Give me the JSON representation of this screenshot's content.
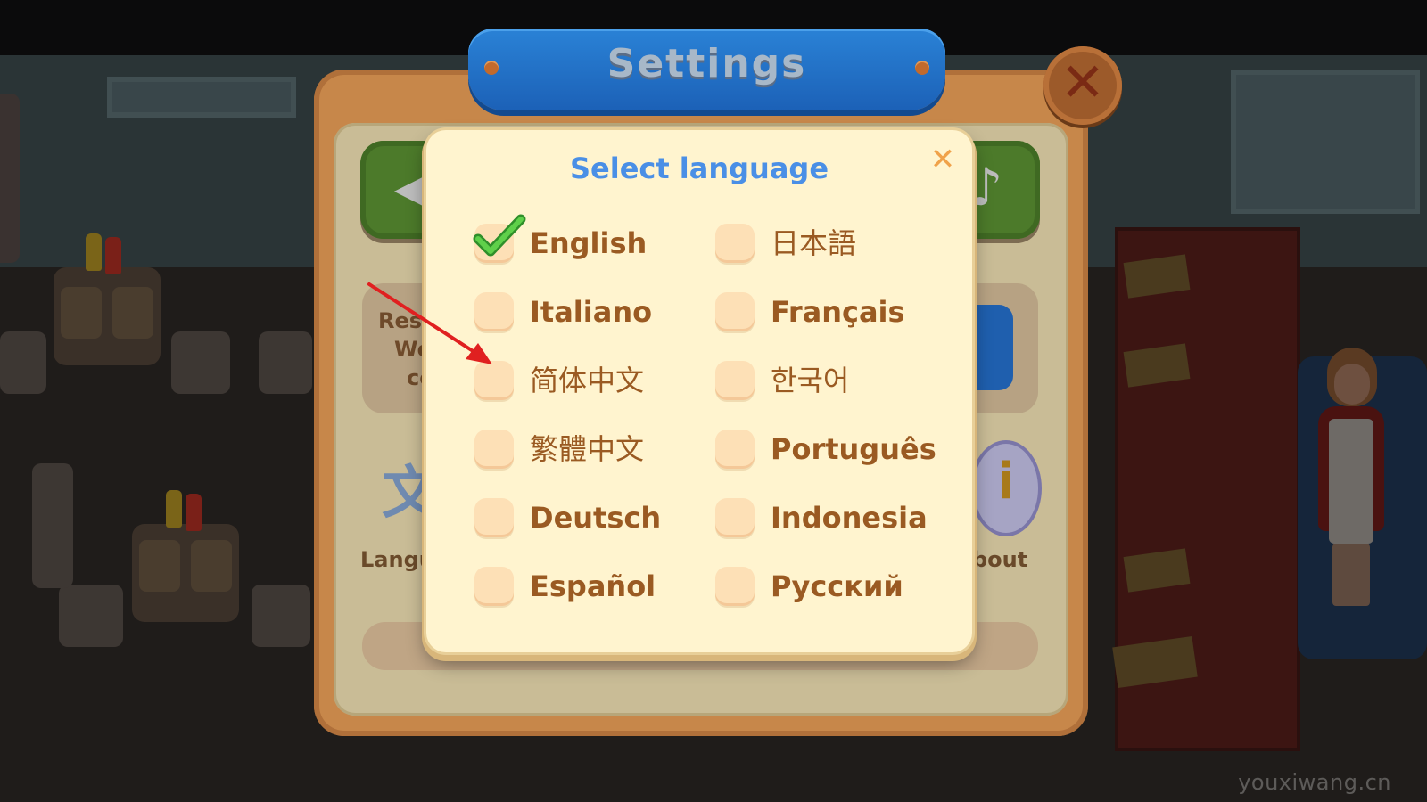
{
  "settings": {
    "title": "Settings",
    "side_text": [
      "Res",
      "We",
      "co"
    ],
    "bottom_labels": {
      "language": "Langu",
      "about": "bout"
    }
  },
  "dialog": {
    "title": "Select language",
    "close_icon": "close-x-icon",
    "options": [
      {
        "label": "English",
        "checked": true
      },
      {
        "label": "日本語",
        "checked": false
      },
      {
        "label": "Italiano",
        "checked": false
      },
      {
        "label": "Français",
        "checked": false
      },
      {
        "label": "简体中文",
        "checked": false
      },
      {
        "label": "한국어",
        "checked": false
      },
      {
        "label": "繁體中文",
        "checked": false
      },
      {
        "label": "Português",
        "checked": false
      },
      {
        "label": "Deutsch",
        "checked": false
      },
      {
        "label": "Indonesia",
        "checked": false
      },
      {
        "label": "Español",
        "checked": false
      },
      {
        "label": "Русский",
        "checked": false
      }
    ]
  },
  "watermark": "youxiwang.cn",
  "colors": {
    "dialog_bg": "#fff4cf",
    "title_blue": "#4a8fe6",
    "label_brown": "#9a5a22",
    "checkbox": "#fde0b6",
    "check_green": "#3cb43c",
    "close_orange": "#f0a24a",
    "annotation_red": "#e02020"
  }
}
